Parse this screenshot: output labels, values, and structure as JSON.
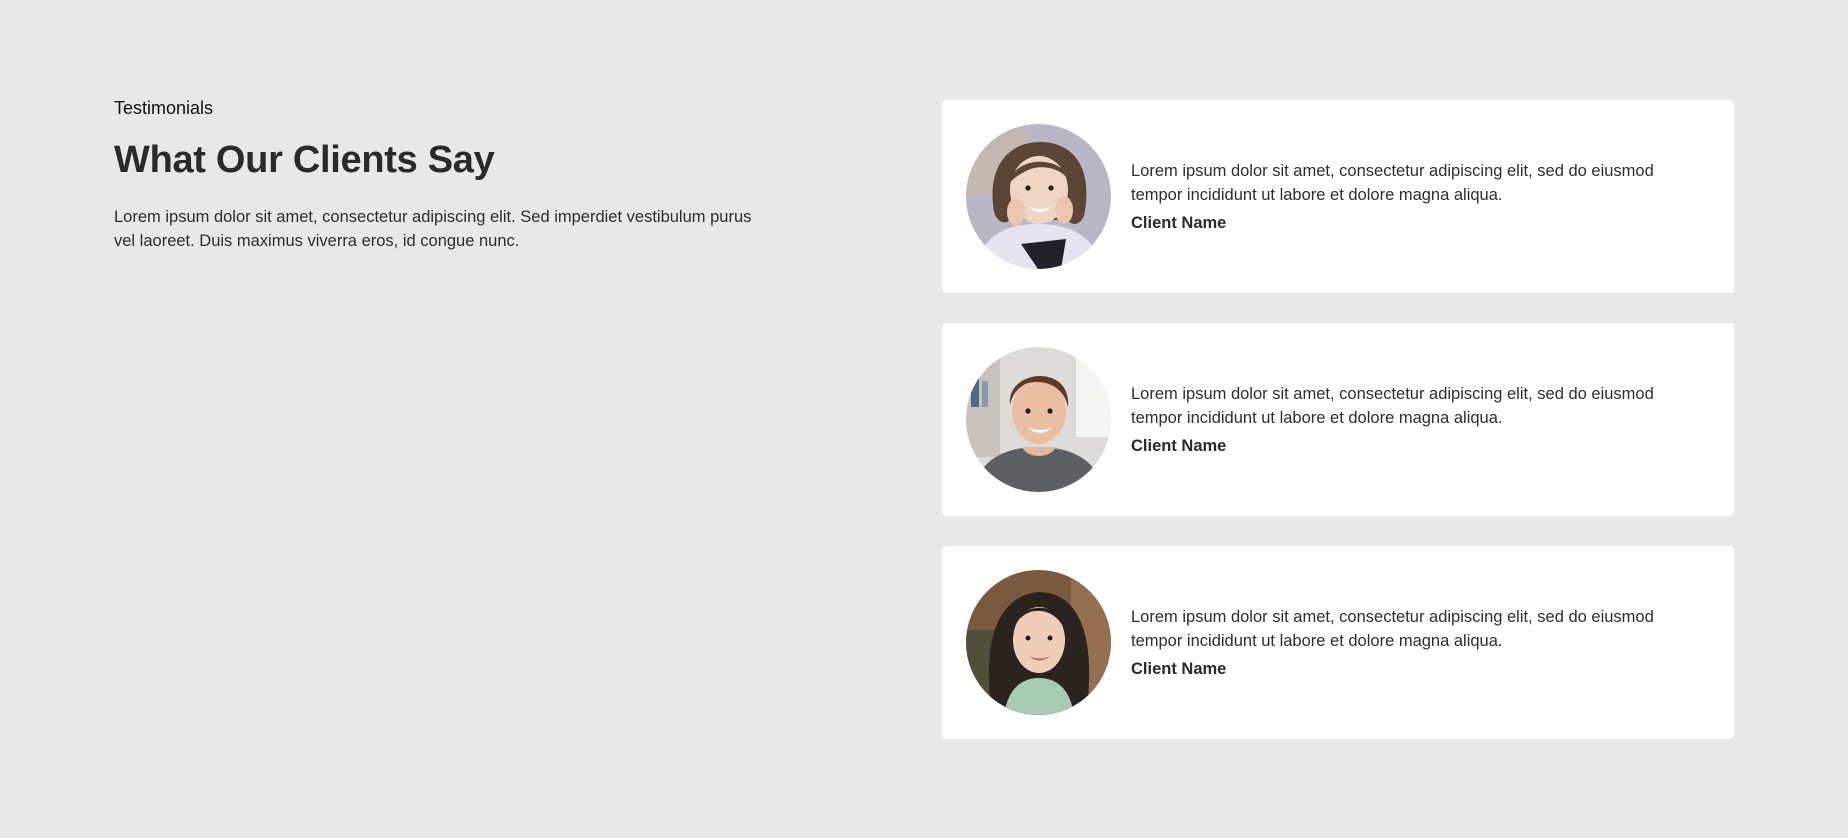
{
  "intro": {
    "eyebrow": "Testimonials",
    "title": "What Our Clients Say",
    "description": "Lorem ipsum dolor sit amet, consectetur adipiscing elit. Sed imperdiet vestibulum purus vel laoreet. Duis maximus viverra eros, id congue nunc."
  },
  "testimonials": [
    {
      "quote": "Lorem ipsum dolor sit amet, consectetur adipiscing elit, sed do eiusmod tempor incididunt ut labore et dolore magna aliqua.",
      "client": "Client Name",
      "avatar": "client-photo-woman-short-hair"
    },
    {
      "quote": "Lorem ipsum dolor sit amet, consectetur adipiscing elit, sed do eiusmod tempor incididunt ut labore et dolore magna aliqua.",
      "client": "Client Name",
      "avatar": "client-photo-man"
    },
    {
      "quote": "Lorem ipsum dolor sit amet, consectetur adipiscing elit, sed do eiusmod tempor incididunt ut labore et dolore magna aliqua.",
      "client": "Client Name",
      "avatar": "client-photo-woman-long-hair"
    }
  ],
  "colors": {
    "page_background": "#e8e8e8",
    "card_background": "#ffffff",
    "text": "#2a2a2a"
  }
}
